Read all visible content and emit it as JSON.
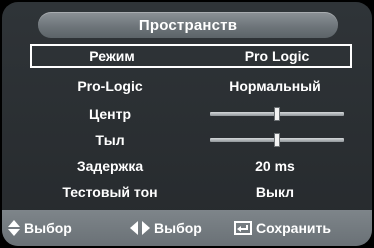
{
  "menu": {
    "title": "Пространств",
    "rows": [
      {
        "label": "Режим",
        "value": "Pro Logic",
        "selected": true
      },
      {
        "label": "Pro-Logic",
        "value": "Нормальный"
      },
      {
        "label": "Центр",
        "slider_level": 0.5
      },
      {
        "label": "Тыл",
        "slider_level": 0.5
      },
      {
        "label": "Задержка",
        "value": "20 ms"
      },
      {
        "label": "Тестовый тон",
        "value": "Выкл"
      }
    ]
  },
  "footer": {
    "move_label": "Выбор",
    "adjust_label": "Выбор",
    "save_label": "Сохранить"
  },
  "icons": {
    "move": "up-down-arrows-icon",
    "adjust": "left-right-arrows-icon",
    "save": "enter-return-icon"
  },
  "colors": {
    "panel": "#2b3034",
    "title_bar": "#7a8186",
    "footer_bar": "#737a7f",
    "text": "#ffffff"
  }
}
